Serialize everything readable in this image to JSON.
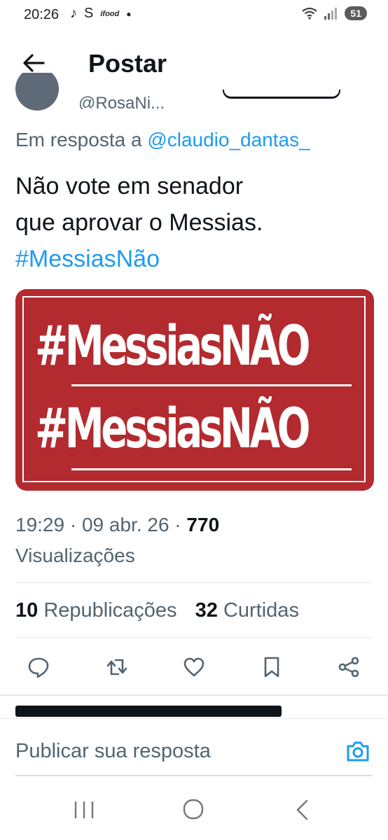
{
  "status_bar": {
    "time": "20:26",
    "app_icons": [
      "tiktok-icon",
      "s-icon",
      "ifood-icon"
    ],
    "ifood_label": "ifood",
    "battery": "51"
  },
  "header": {
    "title": "Postar"
  },
  "author": {
    "handle": "@RosaNi..."
  },
  "tweet": {
    "reply_prefix": "Em resposta a ",
    "reply_mention": "@claudio_dantas_",
    "text_line1": "Não vote em senador",
    "text_line2": "que aprovar o Messias.",
    "hashtag": "#MessiasNão",
    "media_line1": "#MessiasNÃO",
    "media_line2": "#MessiasNÃO",
    "time": "19:29",
    "date": "09 abr. 26",
    "views_count": "770",
    "views_label": "Visualizações",
    "retweets_count": "10",
    "retweets_label": "Republicações",
    "likes_count": "32",
    "likes_label": "Curtidas"
  },
  "composer": {
    "placeholder": "Publicar sua resposta"
  },
  "colors": {
    "accent": "#1d9bf0",
    "text_primary": "#0f1419",
    "text_secondary": "#536471",
    "media_bg": "#b32a2f"
  }
}
